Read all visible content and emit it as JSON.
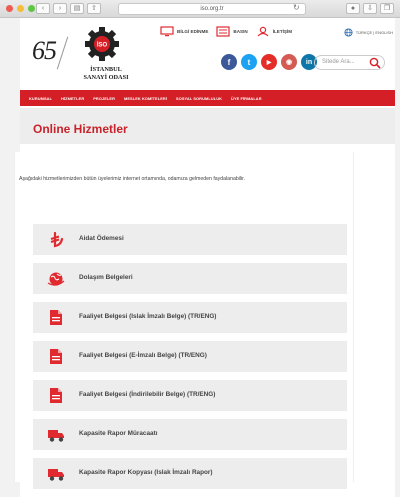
{
  "browser": {
    "url": "iso.org.tr"
  },
  "header": {
    "anniversary": "65",
    "org_name_line1": "İSTANBUL",
    "org_name_line2": "SANAYİ ODASI",
    "top_links": [
      {
        "label": "BİLGİ EDİNME",
        "icon": "monitor-icon"
      },
      {
        "label": "BASIN",
        "icon": "newspaper-icon"
      },
      {
        "label": "İLETİŞİM",
        "icon": "contact-icon"
      }
    ],
    "language": "TÜRKÇE | ENGLISH",
    "socials": [
      {
        "letter": "f",
        "name": "facebook-icon",
        "color": "#3b5998"
      },
      {
        "letter": "t",
        "name": "twitter-icon",
        "color": "#1da1f2"
      },
      {
        "letter": "▶",
        "name": "youtube-icon",
        "color": "#e52d27"
      },
      {
        "letter": "◉",
        "name": "instagram-icon",
        "color": "#d35b54"
      },
      {
        "letter": "in",
        "name": "linkedin-icon",
        "color": "#0e76a8"
      }
    ],
    "search_placeholder": "Sitede Ara..."
  },
  "nav": {
    "items": [
      "KURUMSAL",
      "HİZMETLER",
      "PROJELER",
      "MESLEK KOMİTELERİ",
      "SOSYAL SORUMLULUK",
      "ÜYE FİRMALAR"
    ],
    "bar_color": "#d41f26"
  },
  "page_title": "Online Hizmetler",
  "intro": "Aşağıdaki hizmetlerimizden bütün üyelerimiz internet ortamında, odamıza gelmeden faydalanabilir.",
  "services": [
    {
      "label": "Aidat Ödemesi",
      "icon": "lira-icon"
    },
    {
      "label": "Dolaşım Belgeleri",
      "icon": "globe-icon"
    },
    {
      "label": "Faaliyet Belgesi (Islak İmzalı Belge) (TR/ENG)",
      "icon": "document-icon"
    },
    {
      "label": "Faaliyet Belgesi (E-İmzalı Belge) (TR/ENG)",
      "icon": "document-icon"
    },
    {
      "label": "Faaliyet Belgesi (İndirilebilir Belge) (TR/ENG)",
      "icon": "document-icon"
    },
    {
      "label": "Kapasite Rapor Müracaatı",
      "icon": "truck-icon"
    },
    {
      "label": "Kapasite Rapor Kopyası (Islak İmzalı Rapor)",
      "icon": "truck-icon"
    }
  ],
  "colors": {
    "accent": "#d41f26",
    "title": "#c8232b",
    "icon": "#e02a2f"
  }
}
